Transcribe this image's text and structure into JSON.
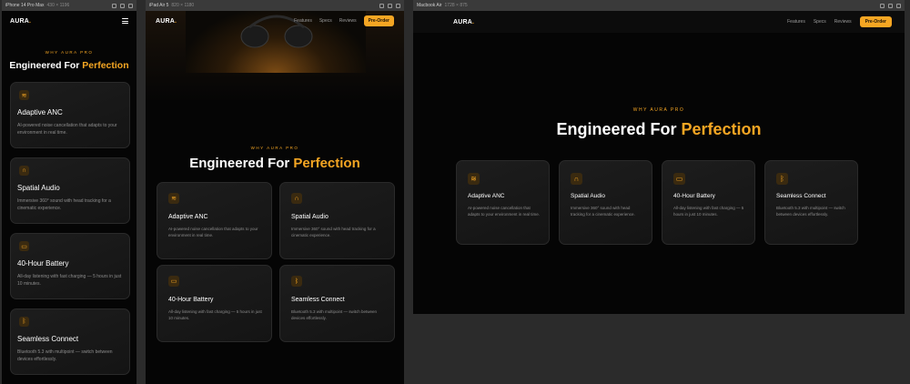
{
  "phone": {
    "device": "iPhone 14 Pro Max",
    "size": "430 × 1196"
  },
  "tablet": {
    "device": "iPad Air 5",
    "size": "820 × 1180"
  },
  "laptop": {
    "device": "Macbook Air",
    "size": "1728 × 875"
  },
  "nav": {
    "logo": "AURA",
    "logo_dot": ".",
    "links": [
      "Features",
      "Specs",
      "Reviews"
    ],
    "cta": "Pre-Order"
  },
  "section": {
    "kicker": "WHY AURA PRO",
    "headline_main": "Engineered For ",
    "headline_accent": "Perfection"
  },
  "features": [
    {
      "icon": "waves-icon",
      "title": "Adaptive ANC",
      "desc": "AI-powered noise cancellation that adapts to your environment in real time."
    },
    {
      "icon": "headphones-icon",
      "title": "Spatial Audio",
      "desc": "Immersive 360° sound with head tracking for a cinematic experience."
    },
    {
      "icon": "battery-icon",
      "title": "40-Hour Battery",
      "desc": "All-day listening with fast charging — 5 hours in just 10 minutes."
    },
    {
      "icon": "bluetooth-icon",
      "title": "Seamless Connect",
      "desc": "Bluetooth 5.3 with multipoint — switch between devices effortlessly."
    }
  ],
  "colors": {
    "accent": "#f5a623",
    "background": "#050505",
    "card": "#1a1a1a"
  }
}
